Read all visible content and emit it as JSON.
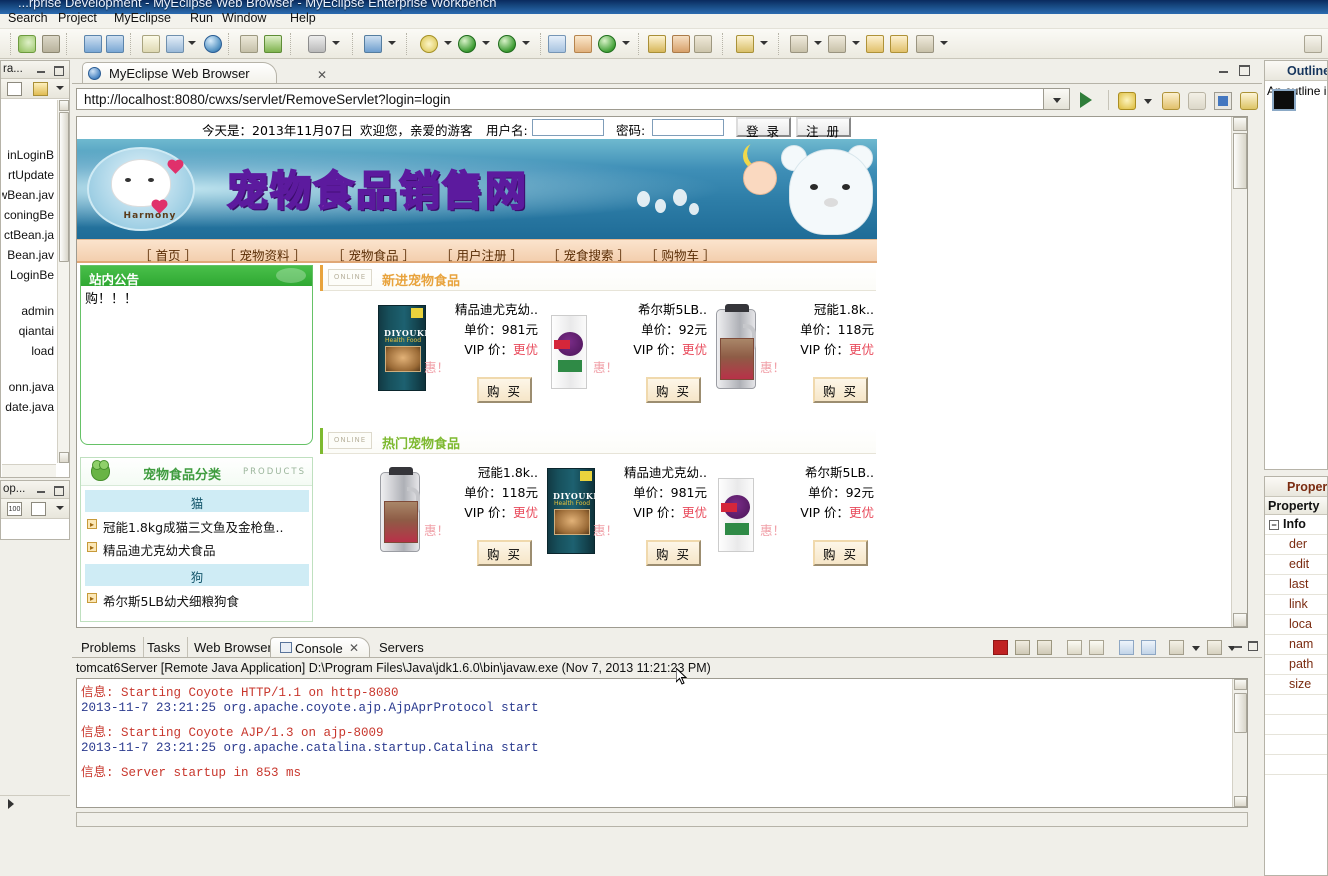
{
  "window": {
    "title": "...rprise Development - MyEclipse Web Browser - MyEclipse Enterprise Workbench",
    "menu": [
      "Search",
      "Project",
      "MyEclipse",
      "Run",
      "Window",
      "Help"
    ]
  },
  "editor": {
    "tab_label": "MyEclipse Web Browser",
    "tab_close": "✕",
    "url": "http://localhost:8080/cwxs/servlet/RemoveServlet?login=login"
  },
  "left_dock": {
    "top_panel_title": "ra...",
    "tree_items": [
      "inLoginB",
      "rtUpdate",
      "wBean.jav",
      "coningBe",
      "ctBean.ja",
      "Bean.jav",
      "LoginBe",
      "admin",
      "qiantai",
      "load",
      "onn.java",
      "date.java"
    ],
    "bottom_panel_title": "op..."
  },
  "right_dock": {
    "outline_title": "Outline",
    "outline_text": "An outline i",
    "properties_title": "Propert",
    "properties_column": "Property",
    "properties_group": "Info",
    "properties_rows": [
      "der",
      "edit",
      "last",
      "link",
      "loca",
      "nam",
      "path",
      "size"
    ]
  },
  "web_page": {
    "top_bar": {
      "date_label": "今天是：2013年11月07日",
      "welcome": "欢迎您，亲爱的游客",
      "username_label": "用户名:",
      "username_value": "",
      "password_label": "密码:",
      "password_value": "",
      "login_button": "登 录",
      "register_button": "注 册"
    },
    "banner": {
      "title": "宠物食品销售网",
      "logo_text": "Harmony"
    },
    "nav": [
      "［ 首页 ］",
      "［ 宠物资料 ］",
      "［ 宠物食品 ］",
      "［ 用户注册 ］",
      "［ 宠食搜索 ］",
      "［ 购物车 ］"
    ],
    "notice": {
      "title": "站内公告",
      "body": "购！！！"
    },
    "category": {
      "title": "宠物食品分类",
      "subtitle": "PRODUCTS",
      "groups": [
        {
          "name": "猫",
          "items": [
            "冠能1.8kg成猫三文鱼及金枪鱼..",
            "精品迪尤克幼犬食品"
          ]
        },
        {
          "name": "狗",
          "items": [
            "希尔斯5LB幼犬细粮狗食"
          ]
        }
      ]
    },
    "sections": [
      {
        "title": "新进宠物食品",
        "color": "#e8a33d",
        "badge": "ONLINE",
        "products": [
          {
            "name": "精品迪尤克幼..",
            "price_label": "单价：",
            "price": "981元",
            "vip_label": "VIP 价：",
            "vip_value": "更优",
            "vip_value2": "惠！",
            "buy": "购 买",
            "art": "pkgbox"
          },
          {
            "name": "希尔斯5LB..",
            "price_label": "单价：",
            "price": "92元",
            "vip_label": "VIP 价：",
            "vip_value": "更优",
            "vip_value2": "惠！",
            "buy": "购 买",
            "art": "can"
          },
          {
            "name": "冠能1.8k..",
            "price_label": "单价：",
            "price": "118元",
            "vip_label": "VIP 价：",
            "vip_value": "更优",
            "vip_value2": "惠！",
            "buy": "购 买",
            "art": "jug"
          }
        ]
      },
      {
        "title": "热门宠物食品",
        "color": "#7db92f",
        "badge": "ONLINE",
        "products": [
          {
            "name": "冠能1.8k..",
            "price_label": "单价：",
            "price": "118元",
            "vip_label": "VIP 价：",
            "vip_value": "更优",
            "vip_value2": "惠！",
            "buy": "购 买",
            "art": "jug"
          },
          {
            "name": "精品迪尤克幼..",
            "price_label": "单价：",
            "price": "981元",
            "vip_label": "VIP 价：",
            "vip_value": "更优",
            "vip_value2": "惠！",
            "buy": "购 买",
            "art": "pkgbox"
          },
          {
            "name": "希尔斯5LB..",
            "price_label": "单价：",
            "price": "92元",
            "vip_label": "VIP 价：",
            "vip_value": "更优",
            "vip_value2": "惠！",
            "buy": "购 买",
            "art": "can"
          }
        ]
      }
    ]
  },
  "bottom_panel": {
    "tabs": [
      "Problems",
      "Tasks",
      "Web Browser",
      "Console",
      "Servers"
    ],
    "active_tab": "Console",
    "active_tab_close": "✕",
    "console_header": "tomcat6Server [Remote Java Application] D:\\Program Files\\Java\\jdk1.6.0\\bin\\javaw.exe (Nov 7, 2013 11:21:23 PM)",
    "console_lines": [
      {
        "text": "信息: Starting Coyote HTTP/1.1 on http-8080",
        "style": "red"
      },
      {
        "text": "2013-11-7 23:21:25 org.apache.coyote.ajp.AjpAprProtocol start",
        "style": "blue"
      },
      {
        "text": "信息: Starting Coyote AJP/1.3 on ajp-8009",
        "style": "red"
      },
      {
        "text": "2013-11-7 23:21:25 org.apache.catalina.startup.Catalina start",
        "style": "blue"
      },
      {
        "text": "信息: Server startup in 853 ms",
        "style": "red"
      }
    ]
  }
}
